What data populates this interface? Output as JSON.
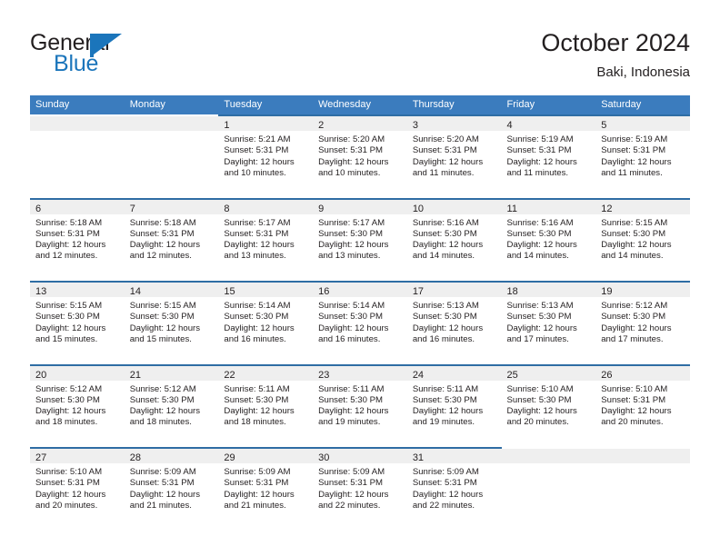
{
  "brand": {
    "name_part1": "General",
    "name_part2": "Blue",
    "icon": "flag-triangle-icon"
  },
  "header": {
    "title": "October 2024",
    "subtitle": "Baki, Indonesia"
  },
  "weekdays": [
    "Sunday",
    "Monday",
    "Tuesday",
    "Wednesday",
    "Thursday",
    "Friday",
    "Saturday"
  ],
  "colors": {
    "header_blue": "#3b7cbe",
    "row_rule_blue": "#2e6da4",
    "brand_blue": "#1b75bb",
    "daynum_band": "#efefef",
    "text": "#231f20"
  },
  "weeks": [
    [
      {
        "day": "",
        "lines": []
      },
      {
        "day": "",
        "lines": []
      },
      {
        "day": "1",
        "lines": [
          "Sunrise: 5:21 AM",
          "Sunset: 5:31 PM",
          "Daylight: 12 hours",
          "and 10 minutes."
        ]
      },
      {
        "day": "2",
        "lines": [
          "Sunrise: 5:20 AM",
          "Sunset: 5:31 PM",
          "Daylight: 12 hours",
          "and 10 minutes."
        ]
      },
      {
        "day": "3",
        "lines": [
          "Sunrise: 5:20 AM",
          "Sunset: 5:31 PM",
          "Daylight: 12 hours",
          "and 11 minutes."
        ]
      },
      {
        "day": "4",
        "lines": [
          "Sunrise: 5:19 AM",
          "Sunset: 5:31 PM",
          "Daylight: 12 hours",
          "and 11 minutes."
        ]
      },
      {
        "day": "5",
        "lines": [
          "Sunrise: 5:19 AM",
          "Sunset: 5:31 PM",
          "Daylight: 12 hours",
          "and 11 minutes."
        ]
      }
    ],
    [
      {
        "day": "6",
        "lines": [
          "Sunrise: 5:18 AM",
          "Sunset: 5:31 PM",
          "Daylight: 12 hours",
          "and 12 minutes."
        ]
      },
      {
        "day": "7",
        "lines": [
          "Sunrise: 5:18 AM",
          "Sunset: 5:31 PM",
          "Daylight: 12 hours",
          "and 12 minutes."
        ]
      },
      {
        "day": "8",
        "lines": [
          "Sunrise: 5:17 AM",
          "Sunset: 5:31 PM",
          "Daylight: 12 hours",
          "and 13 minutes."
        ]
      },
      {
        "day": "9",
        "lines": [
          "Sunrise: 5:17 AM",
          "Sunset: 5:30 PM",
          "Daylight: 12 hours",
          "and 13 minutes."
        ]
      },
      {
        "day": "10",
        "lines": [
          "Sunrise: 5:16 AM",
          "Sunset: 5:30 PM",
          "Daylight: 12 hours",
          "and 14 minutes."
        ]
      },
      {
        "day": "11",
        "lines": [
          "Sunrise: 5:16 AM",
          "Sunset: 5:30 PM",
          "Daylight: 12 hours",
          "and 14 minutes."
        ]
      },
      {
        "day": "12",
        "lines": [
          "Sunrise: 5:15 AM",
          "Sunset: 5:30 PM",
          "Daylight: 12 hours",
          "and 14 minutes."
        ]
      }
    ],
    [
      {
        "day": "13",
        "lines": [
          "Sunrise: 5:15 AM",
          "Sunset: 5:30 PM",
          "Daylight: 12 hours",
          "and 15 minutes."
        ]
      },
      {
        "day": "14",
        "lines": [
          "Sunrise: 5:15 AM",
          "Sunset: 5:30 PM",
          "Daylight: 12 hours",
          "and 15 minutes."
        ]
      },
      {
        "day": "15",
        "lines": [
          "Sunrise: 5:14 AM",
          "Sunset: 5:30 PM",
          "Daylight: 12 hours",
          "and 16 minutes."
        ]
      },
      {
        "day": "16",
        "lines": [
          "Sunrise: 5:14 AM",
          "Sunset: 5:30 PM",
          "Daylight: 12 hours",
          "and 16 minutes."
        ]
      },
      {
        "day": "17",
        "lines": [
          "Sunrise: 5:13 AM",
          "Sunset: 5:30 PM",
          "Daylight: 12 hours",
          "and 16 minutes."
        ]
      },
      {
        "day": "18",
        "lines": [
          "Sunrise: 5:13 AM",
          "Sunset: 5:30 PM",
          "Daylight: 12 hours",
          "and 17 minutes."
        ]
      },
      {
        "day": "19",
        "lines": [
          "Sunrise: 5:12 AM",
          "Sunset: 5:30 PM",
          "Daylight: 12 hours",
          "and 17 minutes."
        ]
      }
    ],
    [
      {
        "day": "20",
        "lines": [
          "Sunrise: 5:12 AM",
          "Sunset: 5:30 PM",
          "Daylight: 12 hours",
          "and 18 minutes."
        ]
      },
      {
        "day": "21",
        "lines": [
          "Sunrise: 5:12 AM",
          "Sunset: 5:30 PM",
          "Daylight: 12 hours",
          "and 18 minutes."
        ]
      },
      {
        "day": "22",
        "lines": [
          "Sunrise: 5:11 AM",
          "Sunset: 5:30 PM",
          "Daylight: 12 hours",
          "and 18 minutes."
        ]
      },
      {
        "day": "23",
        "lines": [
          "Sunrise: 5:11 AM",
          "Sunset: 5:30 PM",
          "Daylight: 12 hours",
          "and 19 minutes."
        ]
      },
      {
        "day": "24",
        "lines": [
          "Sunrise: 5:11 AM",
          "Sunset: 5:30 PM",
          "Daylight: 12 hours",
          "and 19 minutes."
        ]
      },
      {
        "day": "25",
        "lines": [
          "Sunrise: 5:10 AM",
          "Sunset: 5:30 PM",
          "Daylight: 12 hours",
          "and 20 minutes."
        ]
      },
      {
        "day": "26",
        "lines": [
          "Sunrise: 5:10 AM",
          "Sunset: 5:31 PM",
          "Daylight: 12 hours",
          "and 20 minutes."
        ]
      }
    ],
    [
      {
        "day": "27",
        "lines": [
          "Sunrise: 5:10 AM",
          "Sunset: 5:31 PM",
          "Daylight: 12 hours",
          "and 20 minutes."
        ]
      },
      {
        "day": "28",
        "lines": [
          "Sunrise: 5:09 AM",
          "Sunset: 5:31 PM",
          "Daylight: 12 hours",
          "and 21 minutes."
        ]
      },
      {
        "day": "29",
        "lines": [
          "Sunrise: 5:09 AM",
          "Sunset: 5:31 PM",
          "Daylight: 12 hours",
          "and 21 minutes."
        ]
      },
      {
        "day": "30",
        "lines": [
          "Sunrise: 5:09 AM",
          "Sunset: 5:31 PM",
          "Daylight: 12 hours",
          "and 22 minutes."
        ]
      },
      {
        "day": "31",
        "lines": [
          "Sunrise: 5:09 AM",
          "Sunset: 5:31 PM",
          "Daylight: 12 hours",
          "and 22 minutes."
        ]
      },
      {
        "day": "",
        "lines": []
      },
      {
        "day": "",
        "lines": []
      }
    ]
  ]
}
